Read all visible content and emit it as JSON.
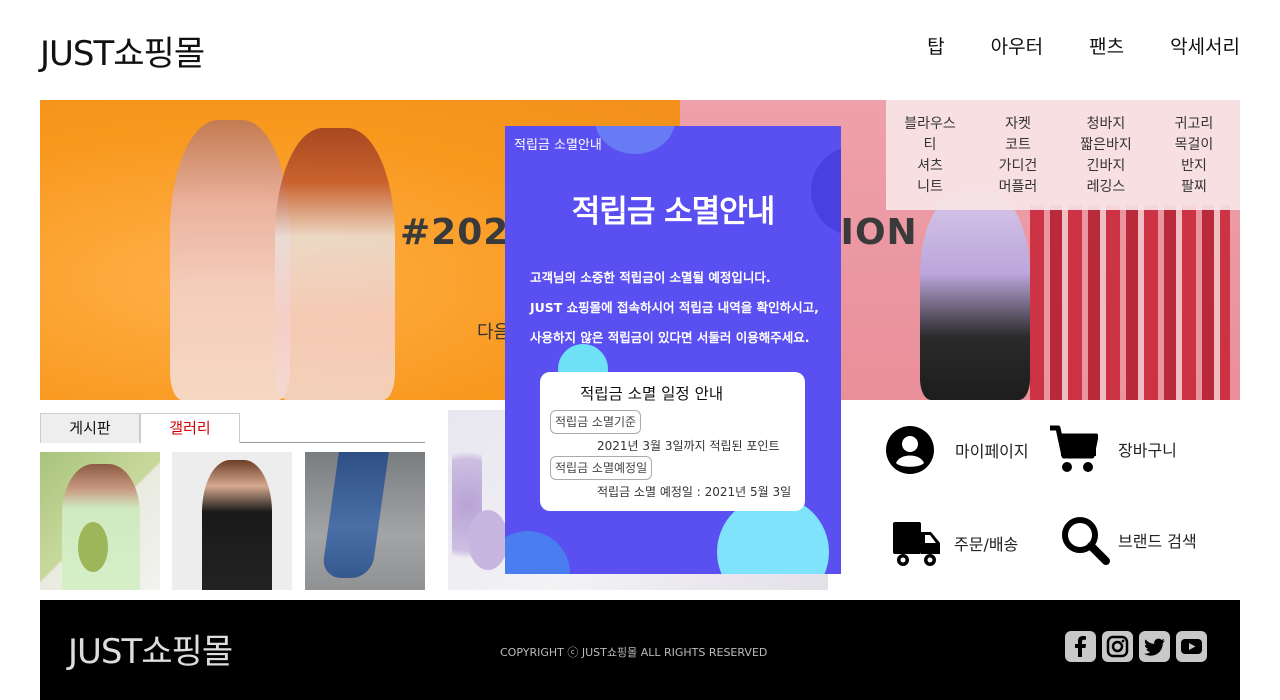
{
  "header": {
    "logo": "JUST쇼핑몰",
    "nav": [
      "탑",
      "아우터",
      "팬츠",
      "악세서리"
    ]
  },
  "banner": {
    "title_left": "#2021",
    "title_right": "TION",
    "subtitle": "다음"
  },
  "mega_menu": [
    [
      "블라우스",
      "티",
      "셔츠",
      "니트"
    ],
    [
      "자켓",
      "코트",
      "가디건",
      "머플러"
    ],
    [
      "청바지",
      "짧은바지",
      "긴바지",
      "레깅스"
    ],
    [
      "귀고리",
      "목걸이",
      "반지",
      "팔찌"
    ]
  ],
  "tabs": [
    "게시판",
    "갤러리"
  ],
  "quick_links": [
    "마이페이지",
    "장바구니",
    "주문/배송",
    "브랜드 검색"
  ],
  "popup": {
    "header": "적립금 소멸안내",
    "title": "적립금 소멸안내",
    "lines": [
      "고객님의 소중한 적립금이 소멸될 예정입니다.",
      "JUST 쇼핑몰에 접속하시어 적립금 내역을 확인하시고,",
      "사용하지 않은 적립금이 있다면 서둘러 이용해주세요."
    ],
    "card": {
      "title": "적립금 소멸 일정 안내",
      "chip1": "적립금 소멸기준",
      "detail1": "2021년 3월 3일까지 적립된 포인트",
      "chip2": "적립금 소멸예정일",
      "detail2": "적립금 소멸 예정일 : 2021년 5월 3일"
    }
  },
  "footer": {
    "logo": "JUST쇼핑몰",
    "copyright": "COPYRIGHT ⓒ JUST쇼핑몰 ALL RIGHTS RESERVED",
    "social_icons": [
      "facebook-icon",
      "instagram-icon",
      "twitter-icon",
      "youtube-icon"
    ]
  }
}
